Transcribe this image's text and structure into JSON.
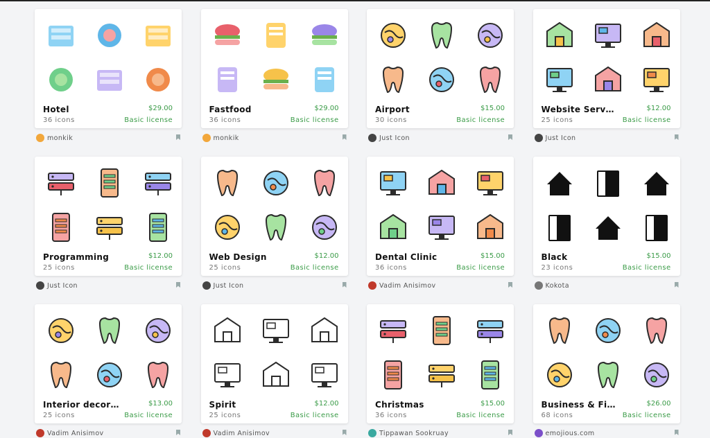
{
  "packs": [
    {
      "title": "Hotel",
      "count": "36 icons",
      "price": "$29.00",
      "license": "Basic license",
      "author": "monkik",
      "avatar_color": "#f2a73b",
      "style": "flat"
    },
    {
      "title": "Fastfood",
      "count": "36 icons",
      "price": "$29.00",
      "license": "Basic license",
      "author": "monkik",
      "avatar_color": "#f2a73b",
      "style": "flat"
    },
    {
      "title": "Airport",
      "count": "30 icons",
      "price": "$15.00",
      "license": "Basic license",
      "author": "Just Icon",
      "avatar_color": "#444444",
      "style": "lineal-color"
    },
    {
      "title": "Website Serv…",
      "count": "25 icons",
      "price": "$12.00",
      "license": "Basic license",
      "author": "Just Icon",
      "avatar_color": "#444444",
      "style": "lineal-color"
    },
    {
      "title": "Programming",
      "count": "25 icons",
      "price": "$12.00",
      "license": "Basic license",
      "author": "Just Icon",
      "avatar_color": "#444444",
      "style": "lineal-color"
    },
    {
      "title": "Web Design",
      "count": "25 icons",
      "price": "$12.00",
      "license": "Basic license",
      "author": "Just Icon",
      "avatar_color": "#444444",
      "style": "lineal-color"
    },
    {
      "title": "Dental Clinic",
      "count": "36 icons",
      "price": "$15.00",
      "license": "Basic license",
      "author": "Vadim Anisimov",
      "avatar_color": "#c0392b",
      "style": "lineal-color"
    },
    {
      "title": "Black",
      "count": "23 icons",
      "price": "$15.00",
      "license": "Basic license",
      "author": "Kokota",
      "avatar_color": "#777777",
      "style": "glyph"
    },
    {
      "title": "Interior decor…",
      "count": "25 icons",
      "price": "$13.00",
      "license": "Basic license",
      "author": "Vadim Anisimov",
      "avatar_color": "#c0392b",
      "style": "lineal-color"
    },
    {
      "title": "Spirit",
      "count": "25 icons",
      "price": "$12.00",
      "license": "Basic license",
      "author": "Vadim Anisimov",
      "avatar_color": "#c0392b",
      "style": "lineal"
    },
    {
      "title": "Christmas",
      "count": "36 icons",
      "price": "$15.00",
      "license": "Basic license",
      "author": "Tippawan Sookruay",
      "avatar_color": "#3aa9a0",
      "style": "lineal-color"
    },
    {
      "title": "Business & Fi…",
      "count": "68 icons",
      "price": "$26.00",
      "license": "Basic license",
      "author": "emojious.com",
      "avatar_color": "#7b4fc9",
      "style": "lineal-color"
    }
  ],
  "icon_names": [
    [
      "toiletries-icon",
      "hotel-building-icon",
      "bathrobe-icon",
      "bathtub-icon",
      "luggage-cart-icon",
      "air-conditioner-icon"
    ],
    [
      "burger-icon",
      "cake-slice-icon",
      "chicken-leg-icon",
      "croissant-icon",
      "cupcake-icon",
      "skewer-icon"
    ],
    [
      "baggage-conveyor-icon",
      "security-gate-icon",
      "parachute-icon",
      "control-tower-icon",
      "globe-icon",
      "boarding-pass-icon"
    ],
    [
      "tablet-server-icon",
      "network-icon",
      "database-server-icon",
      "server-transfer-icon",
      "server-rack-icon",
      "server-monitor-icon"
    ],
    [
      "code-bug-icon",
      "browser-bug-icon",
      "monitor-bug-icon",
      "mobile-list-icon",
      "monitor-code-icon",
      "error-404-icon"
    ],
    [
      "wireframe-icon",
      "idea-pen-icon",
      "vector-monitor-icon",
      "layout-grid-icon",
      "image-gallery-icon",
      "design-tools-icon"
    ],
    [
      "sparkling-tooth-icon",
      "tooth-pain-icon",
      "tooth-icon",
      "dental-implant-icon",
      "dental-tools-icon",
      "dental-chair-icon"
    ],
    [
      "shop-icon",
      "house-tag-icon",
      "download-basket-icon",
      "fire-icon",
      "fridge-icon",
      "tshirt-icon"
    ],
    [
      "desk-lamp-icon",
      "window-grid-icon",
      "file-tray-icon",
      "recycle-bin-icon",
      "keyboard-icon",
      "color-palette-icon"
    ],
    [
      "commandments-icon",
      "torii-gate-icon",
      "church-icon",
      "kaaba-icon",
      "taj-mahal-icon",
      "ox-icon"
    ],
    [
      "snowflake-icon",
      "snow-globe-icon",
      "gift-bag-icon",
      "christmas-sweater-icon",
      "christmas-stocking-icon",
      "sleigh-icon"
    ],
    [
      "emoji-phone-icon",
      "office-building-icon",
      "team-hierarchy-icon",
      "emoji-puzzle-icon",
      "safe-box-icon",
      "bitcoin-mind-icon"
    ]
  ]
}
